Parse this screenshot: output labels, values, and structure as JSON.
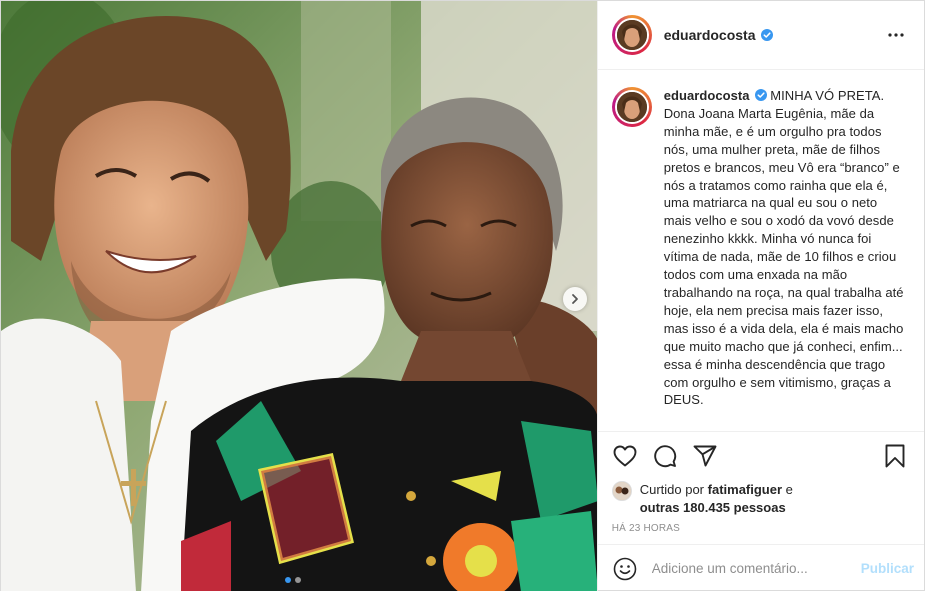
{
  "post": {
    "username": "eduardocosta",
    "verified": true,
    "caption_title": "MINHA VÓ PRETA.",
    "caption_body": "Dona Joana Marta Eugênia, mãe da minha mãe, e é um orgulho pra todos nós, uma mulher preta, mãe de filhos pretos e brancos, meu Vô era “branco” e nós a tratamos como rainha que ela é, uma matriarca na qual eu sou o neto mais velho e sou o xodó da vovó desde nenezinho kkkk. Minha vó nunca foi vítima de nada, mãe de 10 filhos e criou todos com uma enxada na mão trabalhando na roça, na qual trabalha até hoje, ela nem precisa mais fazer isso, mas isso é a vida dela, ela é mais macho que muito macho que já conheci, enfim... essa é minha descendência que trago com orgulho e sem vitimismo, graças a DEUS.",
    "liked_by_prefix": "Curtido por",
    "liked_by_user": "fatimafiguer",
    "liked_by_connector": "e",
    "liked_by_others": "outras 180.435 pessoas",
    "time_ago": "HÁ 23 HORAS",
    "carousel": {
      "current": 1,
      "total": 2
    }
  },
  "comment": {
    "placeholder": "Adicione um comentário...",
    "post_label": "Publicar"
  },
  "icons": {
    "more": "more-options-icon",
    "verified": "verified-badge-icon",
    "like": "heart-icon",
    "comment": "comment-icon",
    "share": "share-icon",
    "save": "bookmark-icon",
    "emoji": "emoji-icon",
    "next": "chevron-right-icon"
  },
  "colors": {
    "verified": "#3897f0",
    "post_button_disabled": "#b2dffc",
    "muted_text": "#8e8e8e"
  }
}
